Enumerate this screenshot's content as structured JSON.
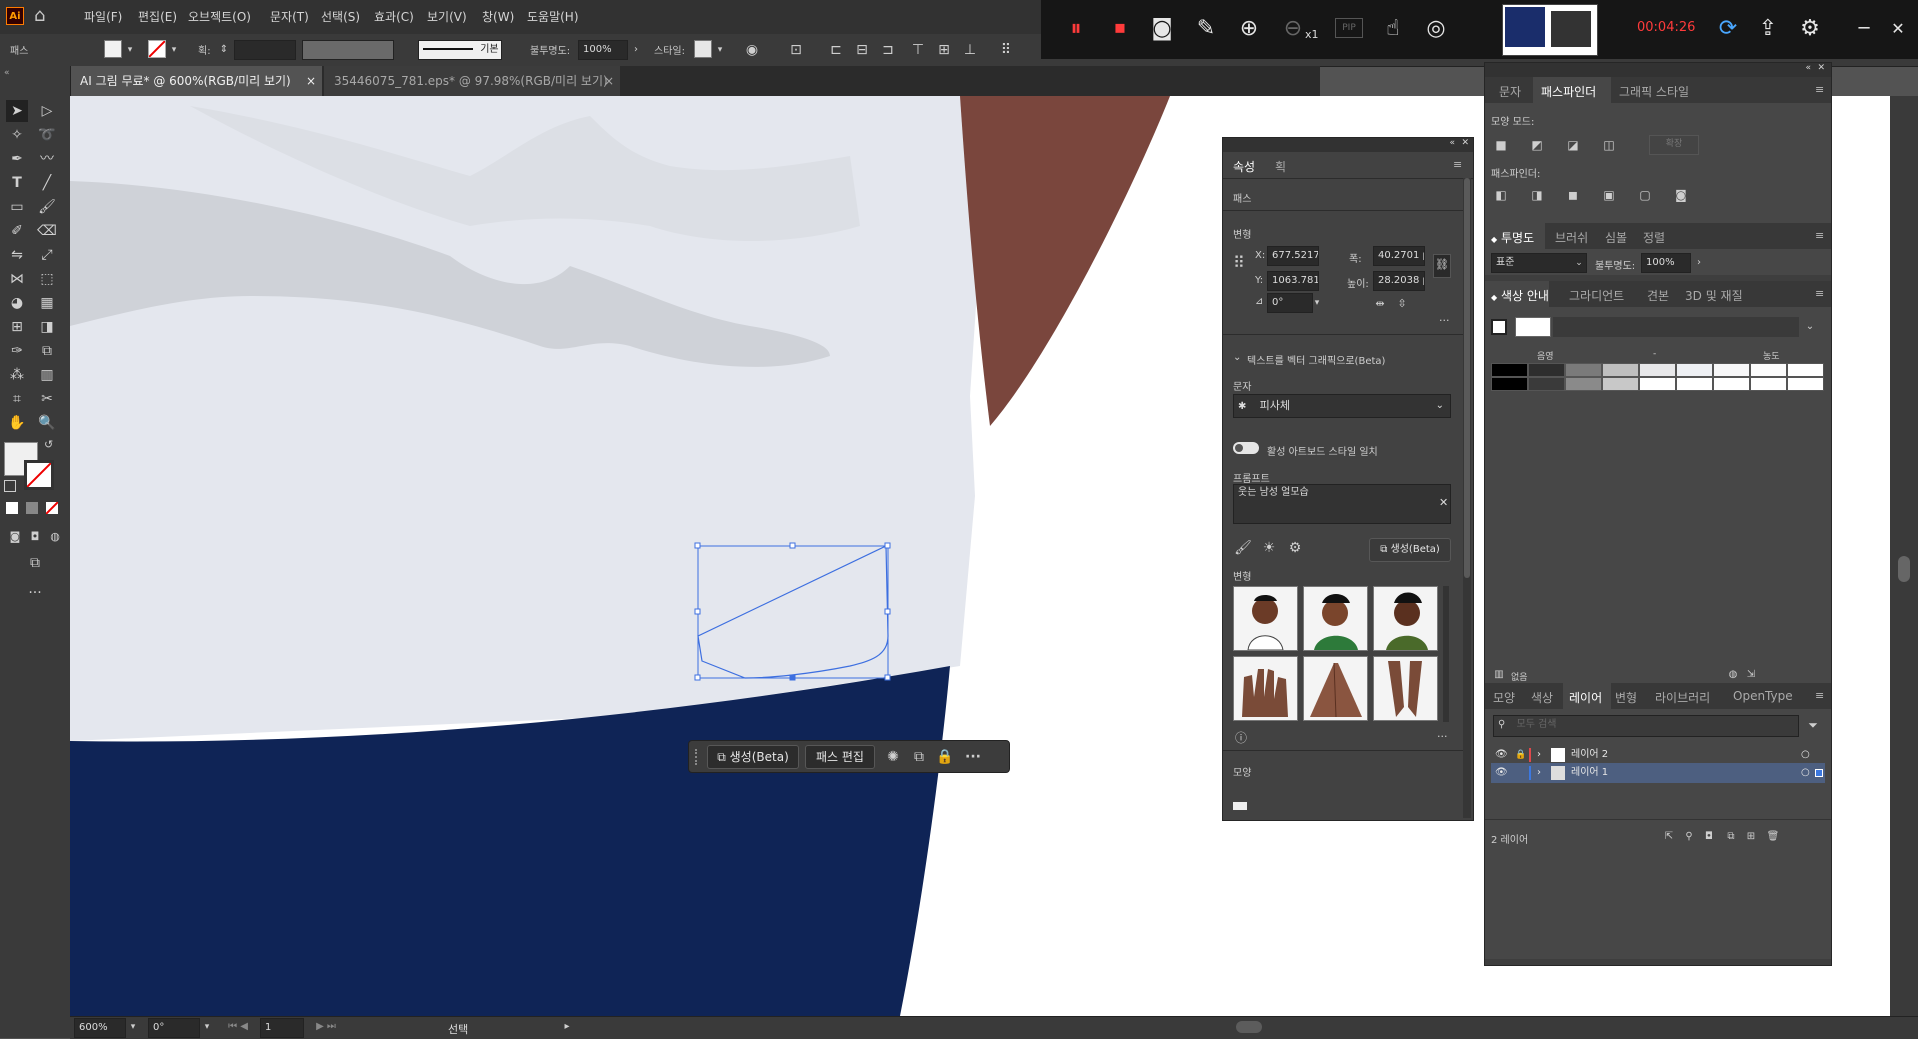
{
  "menus": [
    "파일(F)",
    "편집(E)",
    "오브젝트(O)",
    "문자(T)",
    "선택(S)",
    "효과(C)",
    "보기(V)",
    "창(W)",
    "도움말(H)"
  ],
  "app_logo": "Ai",
  "control_bar": {
    "object_type": "패스",
    "stroke_label": "획:",
    "stroke_style": "기본",
    "opacity_label": "불투명도:",
    "opacity_value": "100%",
    "style_label": "스타일:"
  },
  "recorder": {
    "time": "00:04:26",
    "zoom_multiplier": "x1",
    "pip_label": "PIP"
  },
  "doc_tabs": [
    {
      "label": "AI 그림 무료* @ 600%(RGB/미리 보기)",
      "close": "×",
      "active": true
    },
    {
      "label": "35446075_781.eps* @ 97.98%(RGB/미리 보기)",
      "close": "×",
      "active": false
    }
  ],
  "canvas": {
    "colors": {
      "shirt": "#e4e7ee",
      "pants": "#0f2456",
      "skin": "#7a463d",
      "shadow": "#cdd0d6",
      "selection": "#3d6fe0"
    }
  },
  "float_bar": {
    "generate": "생성(Beta)",
    "edit_path": "패스 편집"
  },
  "status": {
    "zoom": "600%",
    "rotation": "0°",
    "artboard": "1",
    "mode": "선택"
  },
  "properties_panel": {
    "tabs": [
      "속성",
      "획"
    ],
    "object": "패스",
    "transform_label": "변형",
    "x_label": "X:",
    "x": "677.5217",
    "y_label": "Y:",
    "y": "1063.7813",
    "w_label": "폭:",
    "w": "40.2701 p",
    "h_label": "높이:",
    "h": "28.2038 p",
    "angle": "0°",
    "text_to_vector": "텍스트를 벡터 그래픽으로(Beta)",
    "type_label": "문자",
    "type_value": "피사체",
    "match_style": "활성 아트보드 스타일 일치",
    "prompt_label": "프롬프트",
    "prompt_value": "웃는 남성 얼모습",
    "generate_btn": "생성(Beta)",
    "variations_label": "변형",
    "appearance_label": "모양"
  },
  "pathfinder_panel": {
    "tabs": [
      "문자",
      "패스파인더",
      "그래픽 스타일"
    ],
    "shape_modes": "모양 모드:",
    "expand": "확장",
    "pathfinders": "패스파인더:"
  },
  "transparency_panel": {
    "tabs": [
      "투명도",
      "브러쉬",
      "심볼",
      "정렬"
    ],
    "blend": "표준",
    "opacity_label": "불투명도:",
    "opacity": "100%"
  },
  "color_guide_panel": {
    "tabs": [
      "색상 안내",
      "그라디언트",
      "견본",
      "3D 및 재질"
    ],
    "shade_label": "음영",
    "tint_label": "농도",
    "none_label": "없음",
    "grid_colors": [
      [
        "#000000",
        "#2e2e2e",
        "#7a7a7a",
        "#bfbfbf",
        "#e8e8ea",
        "#eef0f4",
        "#f7f7f8",
        "#fcfcfc",
        "#ffffff"
      ],
      [
        "#000000",
        "#3a3a3a",
        "#8a8a8a",
        "#c8c8c8",
        "#ffffff",
        "#ffffff",
        "#ffffff",
        "#ffffff",
        "#ffffff"
      ]
    ]
  },
  "layers_panel": {
    "tabs": [
      "모양",
      "색상",
      "레이어",
      "변형",
      "라이브러리",
      "OpenType"
    ],
    "search_placeholder": "모두 검색",
    "layers": [
      {
        "name": "레이어 2",
        "color": "#e0484b",
        "selected": false
      },
      {
        "name": "레이어 1",
        "color": "#3c78e0",
        "selected": true
      }
    ],
    "count": "2 레이어"
  }
}
